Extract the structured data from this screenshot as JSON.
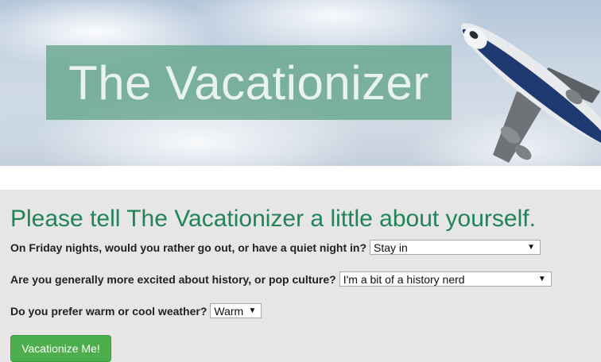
{
  "hero": {
    "title": "The Vacationizer"
  },
  "form": {
    "heading": "Please tell The Vacationizer a little about yourself.",
    "questions": [
      {
        "label": "On Friday nights, would you rather go out, or have a quiet night in?",
        "selected": "Stay in"
      },
      {
        "label": "Are you generally more excited about history, or pop culture?",
        "selected": "I'm a bit of a history nerd"
      },
      {
        "label": "Do you prefer warm or cool weather?",
        "selected": "Warm"
      }
    ],
    "submit_label": "Vacationize Me!"
  },
  "colors": {
    "heading": "#22835a",
    "button": "#4cae4c",
    "title_box": "#5aa082"
  }
}
